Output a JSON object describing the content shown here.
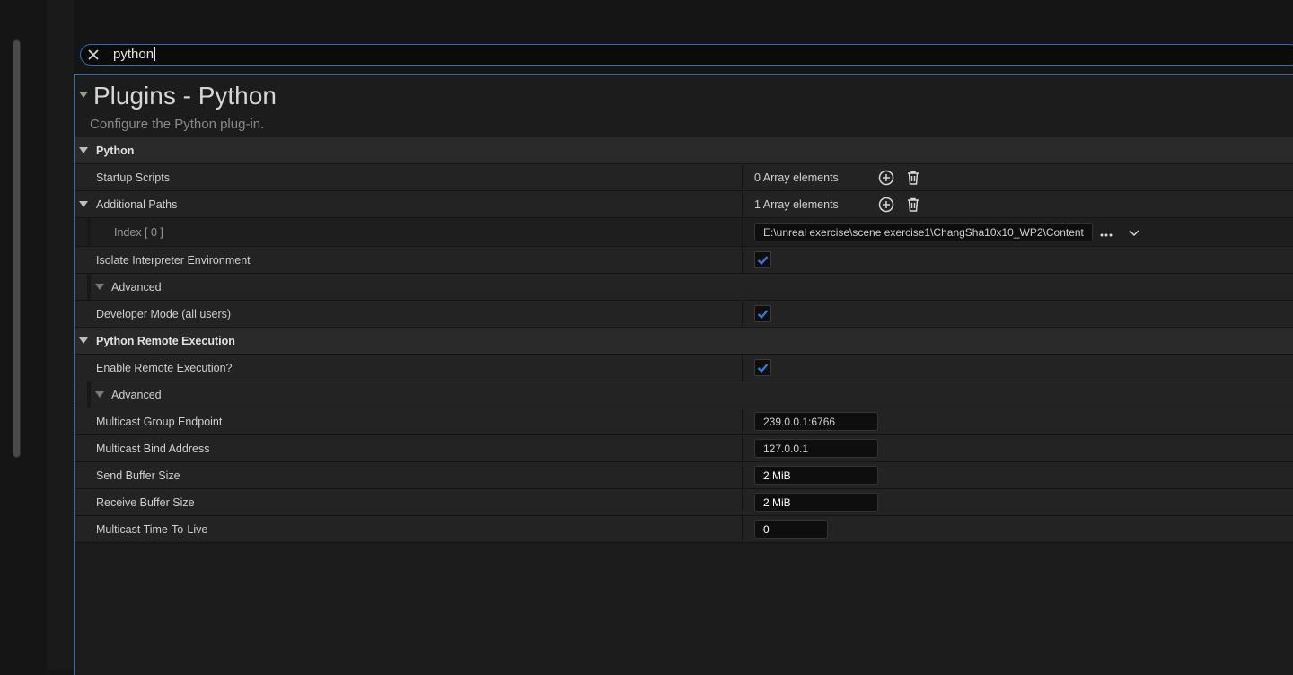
{
  "search": {
    "query": "python"
  },
  "section": {
    "title": "Plugins - Python",
    "description": "Configure the Python plug-in."
  },
  "python": {
    "category": "Python",
    "startup_scripts": {
      "label": "Startup Scripts",
      "value": "0 Array elements"
    },
    "additional_paths": {
      "label": "Additional Paths",
      "value": "1 Array elements"
    },
    "index0": {
      "label": "Index [ 0 ]",
      "value": "E:\\unreal exercise\\scene exercise1\\ChangSha10x10_WP2\\Content"
    },
    "isolate": {
      "label": "Isolate Interpreter Environment",
      "checked": true
    },
    "advanced": {
      "label": "Advanced"
    },
    "developer_mode": {
      "label": "Developer Mode (all users)",
      "checked": true
    }
  },
  "remote": {
    "category": "Python Remote Execution",
    "enable": {
      "label": "Enable Remote Execution?",
      "checked": true
    },
    "advanced": {
      "label": "Advanced"
    },
    "group_endpoint": {
      "label": "Multicast Group Endpoint",
      "value": "239.0.0.1:6766"
    },
    "bind_address": {
      "label": "Multicast Bind Address",
      "value": "127.0.0.1"
    },
    "send_buffer": {
      "label": "Send Buffer Size",
      "value": "2 MiB"
    },
    "receive_buffer": {
      "label": "Receive Buffer Size",
      "value": "2 MiB"
    },
    "ttl": {
      "label": "Multicast Time-To-Live",
      "value": "0"
    }
  },
  "colors": {
    "accent": "#2a6ec4",
    "check": "#2f7fe0",
    "panel": "#232323"
  },
  "icons": [
    "close-icon",
    "add-icon",
    "trash-icon",
    "ellipsis-icon",
    "chevron-down-icon",
    "check-icon",
    "collapse-arrow-icon"
  ]
}
